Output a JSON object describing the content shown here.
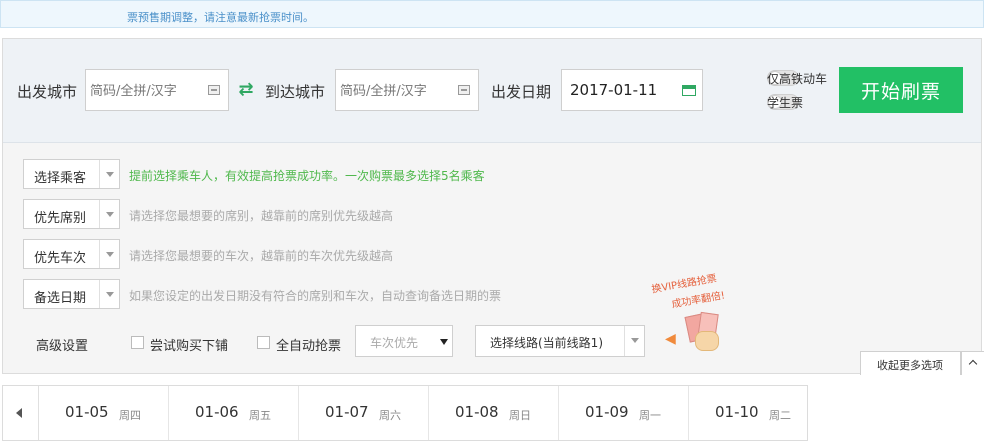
{
  "notice": {
    "text": "票预售期调整，请注意最新抢票时间。"
  },
  "search": {
    "from_label": "出发城市",
    "from_placeholder": "简码/全拼/汉字",
    "to_label": "到达城市",
    "to_placeholder": "简码/全拼/汉字",
    "date_label": "出发日期",
    "date_value": "2017-01-11",
    "toggles": [
      {
        "label": "仅高铁动车",
        "on": false
      },
      {
        "label": "学生票",
        "on": false
      }
    ],
    "start_button": "开始刷票"
  },
  "options": [
    {
      "label": "选择乘客",
      "hint": "提前选择乘车人，有效提高抢票成功率。一次购票最多选择5名乘客",
      "hint_color": "#4fb84c"
    },
    {
      "label": "优先席别",
      "hint": "请选择您最想要的席别，越靠前的席别优先级越高"
    },
    {
      "label": "优先车次",
      "hint": "请选择您最想要的车次，越靠前的车次优先级越高"
    },
    {
      "label": "备选日期",
      "hint": "如果您设定的出发日期没有符合的席别和车次，自动查询备选日期的票"
    }
  ],
  "advanced": {
    "label": "高级设置",
    "try_lower_berth": "尝试购买下铺",
    "auto_grab": "全自动抢票",
    "priority_select": "车次优先",
    "route_select": "选择线路(当前线路1)"
  },
  "vip_promo": {
    "line1": "换VIP线路抢票",
    "line2": "成功率翻倍!"
  },
  "collapse_button": "收起更多选项",
  "dates": [
    {
      "date": "01-05",
      "weekday": "周四"
    },
    {
      "date": "01-06",
      "weekday": "周五"
    },
    {
      "date": "01-07",
      "weekday": "周六"
    },
    {
      "date": "01-08",
      "weekday": "周日"
    },
    {
      "date": "01-09",
      "weekday": "周一"
    },
    {
      "date": "01-10",
      "weekday": "周二"
    }
  ],
  "colors": {
    "accent_green": "#22c065",
    "hint_green": "#4fb84c",
    "notice_blue": "#4a90c9"
  }
}
